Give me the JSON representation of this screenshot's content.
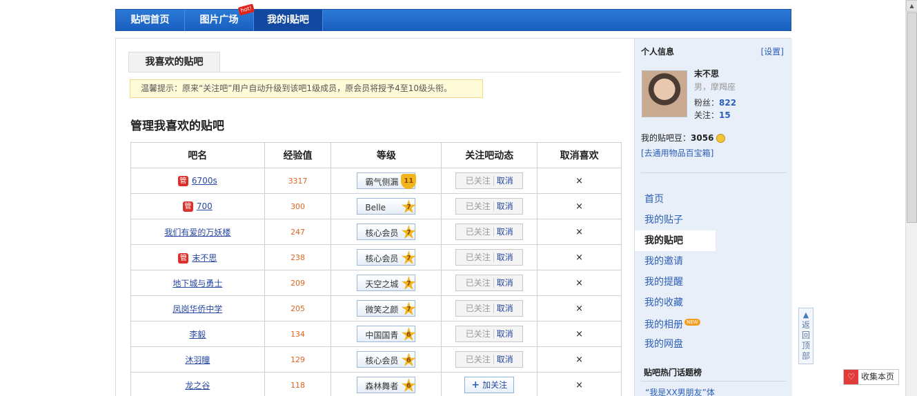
{
  "topnav": {
    "tabs": [
      {
        "label": "贴吧首页"
      },
      {
        "label": "图片广场"
      },
      {
        "label": "我的i贴吧"
      }
    ],
    "hot_badge": "hot!"
  },
  "content": {
    "subtab": "我喜欢的贴吧",
    "tip": "温馨提示：原来“关注吧”用户自动升级到该吧1级成员，原会员将授予4至10级头衔。",
    "section_title": "管理我喜欢的贴吧",
    "table": {
      "headers": [
        "吧名",
        "经验值",
        "等级",
        "关注吧动态",
        "取消喜欢"
      ],
      "follow_done_label": "已关注",
      "follow_cancel_label": "取消",
      "add_follow_label": "加关注",
      "cancel_symbol": "×",
      "member_icon_label": "管",
      "rows": [
        {
          "name": "6700s",
          "member_icon": true,
          "exp": "3317",
          "title": "霸气侧漏",
          "level": "11",
          "badge": "shield",
          "followed": true
        },
        {
          "name": "700",
          "member_icon": true,
          "exp": "300",
          "title": "Belle",
          "level": "7",
          "badge": "star",
          "followed": true
        },
        {
          "name": "我们有爱的万妖楼",
          "member_icon": false,
          "exp": "247",
          "title": "核心会员",
          "level": "7",
          "badge": "star",
          "followed": true
        },
        {
          "name": "末不思",
          "member_icon": true,
          "exp": "238",
          "title": "核心会员",
          "level": "7",
          "badge": "star",
          "followed": true
        },
        {
          "name": "地下城与勇士",
          "member_icon": false,
          "exp": "209",
          "title": "天空之城",
          "level": "7",
          "badge": "star",
          "followed": true
        },
        {
          "name": "凤岗华侨中学",
          "member_icon": false,
          "exp": "205",
          "title": "微笑之颜",
          "level": "7",
          "badge": "star",
          "followed": true
        },
        {
          "name": "李毅",
          "member_icon": false,
          "exp": "134",
          "title": "中国国青",
          "level": "6",
          "badge": "star",
          "followed": true
        },
        {
          "name": "沐羽瞳",
          "member_icon": false,
          "exp": "129",
          "title": "核心会员",
          "level": "6",
          "badge": "star",
          "followed": true
        },
        {
          "name": "龙之谷",
          "member_icon": false,
          "exp": "118",
          "title": "森林舞者",
          "level": "6",
          "badge": "star",
          "followed": false
        }
      ]
    }
  },
  "sidebar": {
    "title": "个人信息",
    "settings": "[设置]",
    "user": {
      "name": "末不思",
      "gender_sign": "男，摩羯座",
      "fans_label": "粉丝：",
      "fans": "822",
      "follow_label": "关注：",
      "follow": "15"
    },
    "beans_label": "我的贴吧豆：",
    "beans": "3056",
    "treasure": "[去通用物品百宝箱]",
    "nav": [
      {
        "label": "首页",
        "active": false,
        "new": false
      },
      {
        "label": "我的贴子",
        "active": false,
        "new": false
      },
      {
        "label": "我的贴吧",
        "active": true,
        "new": false
      },
      {
        "label": "我的邀请",
        "active": false,
        "new": false
      },
      {
        "label": "我的提醒",
        "active": false,
        "new": false
      },
      {
        "label": "我的收藏",
        "active": false,
        "new": false
      },
      {
        "label": "我的相册",
        "active": false,
        "new": true
      },
      {
        "label": "我的网盘",
        "active": false,
        "new": false
      }
    ],
    "new_badge": "NEW",
    "hot_title": "贴吧热门话题榜",
    "hot_item": "“我是XX男朋友”体"
  },
  "backtop": {
    "label": "返回顶部"
  },
  "collect": {
    "label": "收集本页"
  }
}
